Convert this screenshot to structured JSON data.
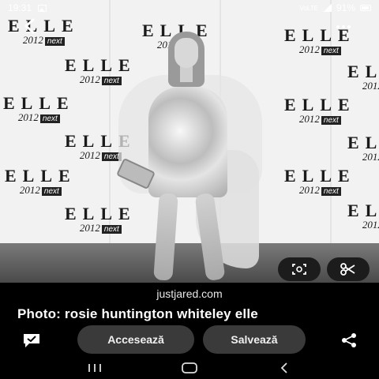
{
  "status_bar": {
    "time": "19:31",
    "signal_label": "VoLTE",
    "battery": "91%"
  },
  "photo": {
    "backdrop_logo": "ELLE",
    "backdrop_year": "2012",
    "backdrop_sponsor": "next"
  },
  "result": {
    "source": "justjared.com",
    "caption": "Photo: rosie huntington whiteley elle"
  },
  "actions": {
    "access_label": "Accesează",
    "save_label": "Salvează"
  },
  "icons": {
    "back": "back-arrow-icon",
    "more": "more-dots-icon",
    "lens": "lens-search-icon",
    "crop": "scissors-icon",
    "comment": "comment-icon",
    "share": "share-icon"
  }
}
